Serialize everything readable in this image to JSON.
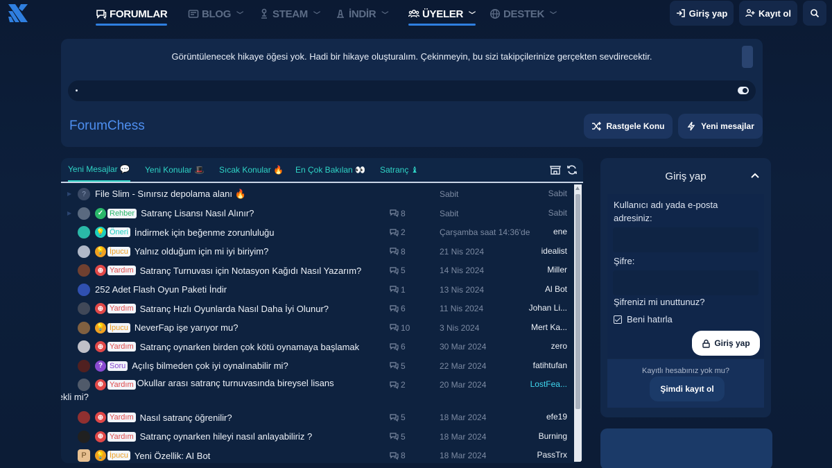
{
  "nav": {
    "items": [
      {
        "label": "FORUMLAR",
        "icon": "chat-icon",
        "active": true
      },
      {
        "label": "BLOG",
        "icon": "blog-icon",
        "active": false
      },
      {
        "label": "STEAM",
        "icon": "steam-icon",
        "active": false
      },
      {
        "label": "İNDİR",
        "icon": "download-icon",
        "active": false
      },
      {
        "label": "ÜYELER",
        "icon": "users-icon",
        "active": true
      },
      {
        "label": "DESTEK",
        "icon": "globe-icon",
        "active": false
      }
    ],
    "login_label": "Giriş yap",
    "register_label": "Kayıt ol"
  },
  "hero": {
    "story_message": "Görüntülenecek hikaye öğesi yok. Hadi bir hikaye oluşturalım. Çekinmeyin, bu sizi takipçilerinize gerçekten sevdirecektir.",
    "brand": "ForumChess",
    "random_button": "Rastgele Konu",
    "new_posts_button": "Yeni mesajlar"
  },
  "tabs": [
    {
      "label": "Yeni Mesajlar 💬",
      "active": true
    },
    {
      "label": "Yeni Konular 🎩",
      "active": false
    },
    {
      "label": "Sıcak Konular 🔥",
      "active": false
    },
    {
      "label": "En Çok Bakılan 👀",
      "active": false
    },
    {
      "label": "Satranç ♝",
      "active": false
    }
  ],
  "threads": [
    {
      "prefix": "",
      "title": "File Slim - Sınırsız depolama alanı 🔥",
      "replies": "",
      "date": "Sabit",
      "user": "Sabit",
      "avatar_color": "#3a4a66"
    },
    {
      "prefix": "Rehber",
      "prefix_icon": "✓",
      "prefix_color": "#2bb86a",
      "title": "Satranç Lisansı Nasıl Alınır?",
      "replies": "8",
      "date": "Sabit",
      "user": "Sabit",
      "avatar_color": "#5a6a80"
    },
    {
      "prefix": "Öneri",
      "prefix_icon": "💡",
      "prefix_color": "#1ccfc0",
      "title": "İndirmek için beğenme zorunluluğu",
      "replies": "2",
      "date": "Çarşamba saat 14:36'de",
      "user": "ene",
      "avatar_color": "#2ab8a8"
    },
    {
      "prefix": "İpucu",
      "prefix_icon": "💡",
      "prefix_color": "#f0a020",
      "title": "Yalnız olduğum için mi iyi biriyim?",
      "replies": "8",
      "date": "21 Nis 2024",
      "user": "idealist",
      "avatar_color": "#b0b8c8"
    },
    {
      "prefix": "Yardım",
      "prefix_icon": "⊕",
      "prefix_color": "#e04848",
      "title": "Satranç Turnuvası için Notasyon Kağıdı Nasıl Yazarım?",
      "replies": "5",
      "date": "14 Nis 2024",
      "user": "Miller",
      "avatar_color": "#704030"
    },
    {
      "prefix": "",
      "title": "252 Adet Flash Oyun Paketi İndir",
      "replies": "1",
      "date": "13 Nis 2024",
      "user": "Al Bot",
      "avatar_color": "#3050b0"
    },
    {
      "prefix": "Yardım",
      "prefix_icon": "⊕",
      "prefix_color": "#e04848",
      "title": "Satranç Hızlı Oyunlarda Nasıl Daha İyi Olunur?",
      "replies": "6",
      "date": "11 Nis 2024",
      "user": "Johan Li...",
      "avatar_color": "#404858"
    },
    {
      "prefix": "İpucu",
      "prefix_icon": "💡",
      "prefix_color": "#f0a020",
      "title": "NeverFap işe yarıyor mu?",
      "replies": "10",
      "date": "3 Nis 2024",
      "user": "Mert Ka...",
      "avatar_color": "#806040"
    },
    {
      "prefix": "Yardım",
      "prefix_icon": "⊕",
      "prefix_color": "#e04848",
      "title": "Satranç oynarken birden çok kötü oynamaya başlamak",
      "replies": "6",
      "date": "30 Mar 2024",
      "user": "zero",
      "avatar_color": "#c0c0c8"
    },
    {
      "prefix": "Soru",
      "prefix_icon": "?",
      "prefix_color": "#8a4ad0",
      "title": "Açılış bilmeden çok iyi oynalınabilir mi?",
      "replies": "5",
      "date": "22 Mar 2024",
      "user": "fatihtufan",
      "avatar_color": "#502020"
    },
    {
      "prefix": "Yardım",
      "prefix_icon": "⊕",
      "prefix_color": "#e04848",
      "title": "Okullar arası satranç turnuvasında bireysel lisans",
      "title2": "gerekli mi?",
      "replies": "2",
      "date": "20 Mar 2024",
      "user": "LostFea...",
      "user_color": "#40d8f0",
      "avatar_color": "#505a6a"
    },
    {
      "prefix": "Yardım",
      "prefix_icon": "⊕",
      "prefix_color": "#e04848",
      "title": "Nasıl satranç öğrenilir?",
      "replies": "5",
      "date": "18 Mar 2024",
      "user": "efe19",
      "avatar_color": "#903030"
    },
    {
      "prefix": "Yardım",
      "prefix_icon": "⊕",
      "prefix_color": "#e04848",
      "title": "Satranç oynarken hileyi nasıl anlayabiliriz ?",
      "replies": "5",
      "date": "18 Mar 2024",
      "user": "Burning",
      "avatar_color": "#202020"
    },
    {
      "prefix": "İpucu",
      "prefix_icon": "💡",
      "prefix_color": "#f0a020",
      "title": "Yeni Özellik: AI Bot",
      "replies": "8",
      "date": "18 Mar 2024",
      "user": "PassTrx",
      "avatar_color": "#e8c090",
      "avatar_letter": "P"
    }
  ],
  "login": {
    "title": "Giriş yap",
    "username_label": "Kullanıcı adı yada e-posta adresiniz:",
    "password_label": "Şifre:",
    "forgot": "Şifrenizi mi unuttunuz?",
    "remember": "Beni hatırla",
    "button": "Giriş yap",
    "no_account": "Kayıtlı hesabınız yok mu?",
    "register_now": "Şimdi kayıt ol"
  }
}
